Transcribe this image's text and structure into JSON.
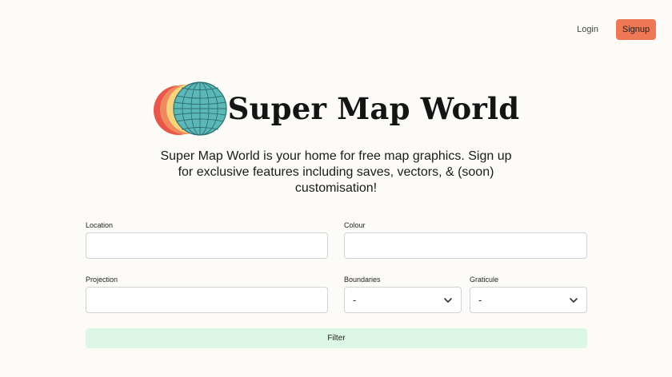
{
  "nav": {
    "login_label": "Login",
    "signup_label": "Signup"
  },
  "brand": {
    "name": "Super Map World"
  },
  "hero": {
    "tagline": "Super Map World is your home for free map graphics. Sign up for exclusive features including saves, vectors, & (soon) customisation!"
  },
  "form": {
    "location": {
      "label": "Location",
      "value": "",
      "placeholder": ""
    },
    "colour": {
      "label": "Colour",
      "value": "",
      "placeholder": ""
    },
    "projection": {
      "label": "Projection",
      "value": "",
      "placeholder": ""
    },
    "boundaries": {
      "label": "Boundaries",
      "selected": "-"
    },
    "graticule": {
      "label": "Graticule",
      "selected": "-"
    },
    "filter_label": "Filter"
  },
  "colors": {
    "accent": "#ee7856",
    "filter_bg": "#dcf7e6",
    "logo_red": "#e8584a",
    "logo_orange": "#f08a5d",
    "logo_yellow": "#f7d37e",
    "logo_globe": "#5bb8b6"
  }
}
